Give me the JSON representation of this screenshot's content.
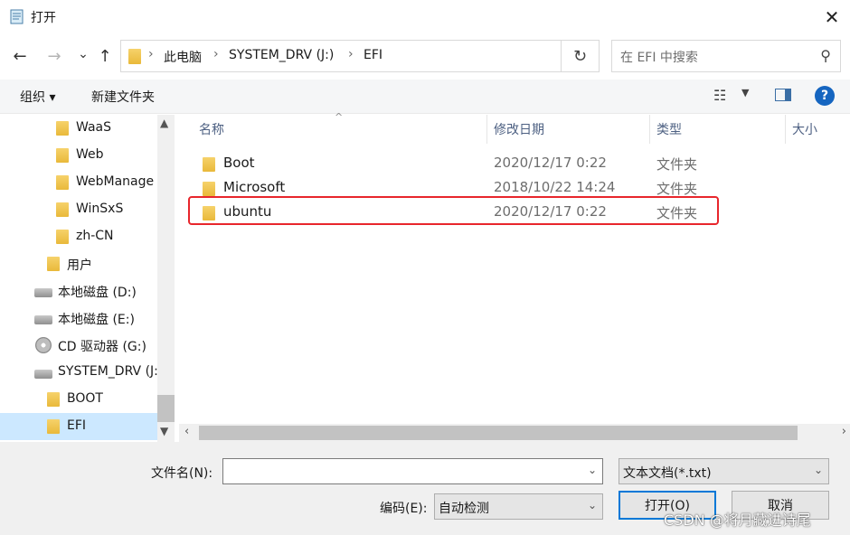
{
  "window": {
    "title": "打开",
    "close_label": "✕"
  },
  "nav": {
    "back": "←",
    "forward": "→",
    "recent": "⌄",
    "up": "↑"
  },
  "address": {
    "breadcrumbs": [
      "此电脑",
      "SYSTEM_DRV (J:)",
      "EFI"
    ],
    "separator": "›",
    "dropdown": "⌄",
    "refresh": "↻"
  },
  "search": {
    "placeholder": "在 EFI 中搜索",
    "icon": "search-icon"
  },
  "toolbar": {
    "organize_label": "组织 ▾",
    "new_folder_label": "新建文件夹",
    "help_label": "?"
  },
  "sidebar": {
    "items": [
      {
        "label": "WaaS",
        "icon": "folder-icon"
      },
      {
        "label": "Web",
        "icon": "folder-icon"
      },
      {
        "label": "WebManage",
        "icon": "folder-icon"
      },
      {
        "label": "WinSxS",
        "icon": "folder-icon"
      },
      {
        "label": "zh-CN",
        "icon": "folder-icon"
      },
      {
        "label": "用户",
        "icon": "folder-icon"
      },
      {
        "label": "本地磁盘 (D:)",
        "icon": "drive-icon"
      },
      {
        "label": "本地磁盘 (E:)",
        "icon": "drive-icon"
      },
      {
        "label": "CD 驱动器 (G:)",
        "icon": "cd-drive-icon"
      },
      {
        "label": "SYSTEM_DRV (J:)",
        "icon": "drive-icon"
      },
      {
        "label": "BOOT",
        "icon": "folder-icon"
      },
      {
        "label": "EFI",
        "icon": "folder-icon",
        "selected": true
      }
    ]
  },
  "files": {
    "columns": [
      "名称",
      "修改日期",
      "类型",
      "大小"
    ],
    "sort_indicator": "^",
    "rows": [
      {
        "name": "Boot",
        "date": "2020/12/17 0:22",
        "type": "文件夹"
      },
      {
        "name": "Microsoft",
        "date": "2018/10/22 14:24",
        "type": "文件夹"
      },
      {
        "name": "ubuntu",
        "date": "2020/12/17 0:22",
        "type": "文件夹"
      }
    ],
    "highlight_color": "#e8262c"
  },
  "bottom": {
    "filename_label": "文件名(N):",
    "filename_value": "",
    "filter_value": "文本文档(*.txt)",
    "encoding_label": "编码(E):",
    "encoding_value": "自动检测",
    "open_label": "打开(O)",
    "cancel_label": "取消",
    "watermark": "CSDN @将月藏进诗尾"
  },
  "colors": {
    "accent": "#0078d7",
    "selection": "#cce8ff",
    "help": "#1565c0"
  }
}
